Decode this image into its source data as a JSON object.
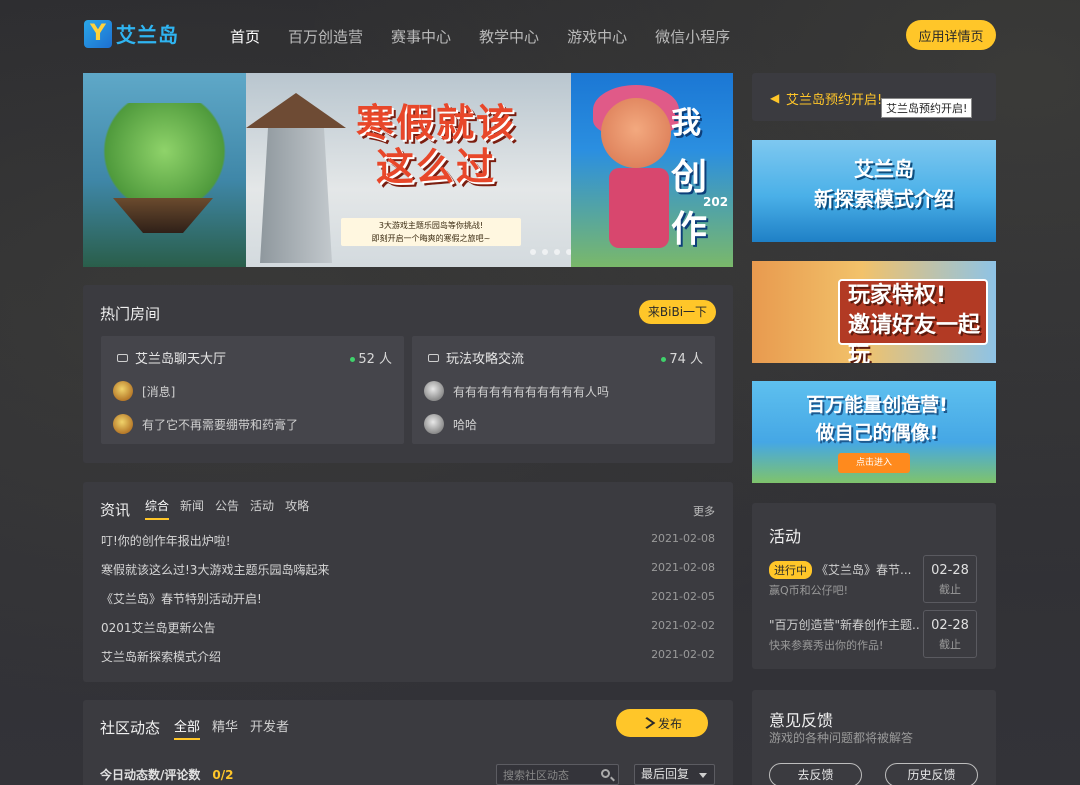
{
  "header": {
    "logo_text": "艾兰岛",
    "logo_mark": "Y",
    "nav": [
      {
        "label": "首页"
      },
      {
        "label": "百万创造营"
      },
      {
        "label": "赛事中心"
      },
      {
        "label": "教学中心"
      },
      {
        "label": "游戏中心"
      },
      {
        "label": "微信小程序"
      }
    ],
    "app_button": "应用详情页"
  },
  "banner": {
    "slide_title_line1": "寒假就该",
    "slide_title_line2": "这么过",
    "slide_sub_line1": "3大游戏主题乐园岛等你挑战!",
    "slide_sub_line2": "即刻开启一个晦爽的寒假之旅吧~",
    "slide_c_text1": "我",
    "slide_c_text2": "创作",
    "slide_c_year": "202"
  },
  "notice": {
    "text": "艾兰岛预约开启!",
    "tooltip": "艾兰岛预约开启!"
  },
  "side_banners": [
    {
      "title_line1": "艾兰岛",
      "title_line2": "新探索模式介绍"
    },
    {
      "title_line1": "玩家特权!",
      "title_line2": "邀请好友一起玩"
    },
    {
      "title_line1": "百万能量创造营!",
      "title_line2": "做自己的偶像!",
      "button": "点击进入"
    }
  ],
  "rooms": {
    "title": "热门房间",
    "bibi_button": "来BiBi一下",
    "items": [
      {
        "name": "艾兰岛聊天大厅",
        "count": "52 人",
        "messages": [
          "[消息]",
          "有了它不再需要绷带和药膏了"
        ]
      },
      {
        "name": "玩法攻略交流",
        "count": "74 人",
        "messages": [
          "有有有有有有有有有有有人吗",
          "哈哈"
        ]
      }
    ]
  },
  "news": {
    "title": "资讯",
    "tabs": [
      "综合",
      "新闻",
      "公告",
      "活动",
      "攻略"
    ],
    "more": "更多",
    "items": [
      {
        "title": "叮!你的创作年报出炉啦!",
        "date": "2021-02-08"
      },
      {
        "title": "寒假就该这么过!3大游戏主题乐园岛嗨起来",
        "date": "2021-02-08"
      },
      {
        "title": "《艾兰岛》春节特别活动开启!",
        "date": "2021-02-05"
      },
      {
        "title": "0201艾兰岛更新公告",
        "date": "2021-02-02"
      },
      {
        "title": "艾兰岛新探索模式介绍",
        "date": "2021-02-02"
      }
    ]
  },
  "activity": {
    "title": "活动",
    "items": [
      {
        "tag": "进行中",
        "name": "《艾兰岛》春节...",
        "desc": "赢Q币和公仔吧!",
        "date": "02-28",
        "status": "截止"
      },
      {
        "tag": "",
        "name": "\"百万创造营\"新春创作主题...",
        "desc": "快来参赛秀出你的作品!",
        "date": "02-28",
        "status": "截止"
      }
    ]
  },
  "feedback": {
    "title": "意见反馈",
    "subtitle": "游戏的各种问题都将被解答",
    "button1": "去反馈",
    "button2": "历史反馈"
  },
  "community": {
    "title": "社区动态",
    "tabs": [
      "全部",
      "精华",
      "开发者"
    ],
    "post_button": "发布",
    "stat_label": "今日动态数/评论数",
    "stat_value": "0/2",
    "search_placeholder": "搜索社区动态",
    "sort_value": "最后回复"
  },
  "colors": {
    "accent": "#ffc629",
    "background": "#2f2f33",
    "panel": "#3b3b40",
    "logo": "#2fb4f1"
  }
}
